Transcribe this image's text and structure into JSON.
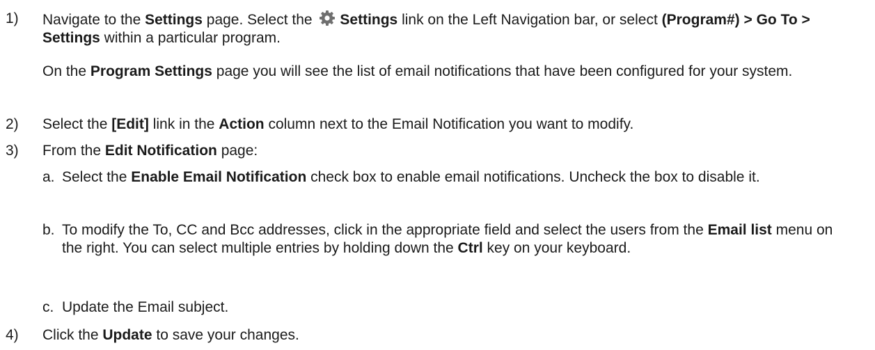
{
  "steps": [
    {
      "num": "1)",
      "a1": "Navigate to the ",
      "a2": "Settings",
      "a3": " page. Select the ",
      "a4": "Settings",
      "a5": " link on the Left Navigation bar, or select ",
      "a6": "(Program#) > Go To > Settings",
      "a7": " within a particular program.",
      "p1": "On the ",
      "p2": "Program Settings",
      "p3": " page you will see the list of email notifications that have been configured for your system."
    },
    {
      "num": "2)",
      "a1": "Select the ",
      "a2": "[Edit]",
      "a3": " link in the ",
      "a4": "Action",
      "a5": " column next to the Email Notification you want to modify."
    },
    {
      "num": "3)",
      "a1": "From the ",
      "a2": "Edit Notification",
      "a3": " page:"
    },
    {
      "num": "4)",
      "a1": "Click the ",
      "a2": "Update",
      "a3": " to save your changes."
    }
  ],
  "substeps": [
    {
      "letter": "a.",
      "a1": "Select the ",
      "a2": "Enable Email Notification",
      "a3": " check box to enable email notifications. Uncheck the box to disable it."
    },
    {
      "letter": "b.",
      "a1": "To modify the To, CC and Bcc addresses, click in the appropriate field and select the users from the ",
      "a2": "Email list",
      "a3": " menu on the right. You can select multiple entries by holding down the ",
      "a4": "Ctrl",
      "a5": " key on your keyboard."
    },
    {
      "letter": "c.",
      "a1": "Update the Email subject."
    }
  ],
  "icons": {
    "settings": "gear-icon",
    "gear_color": "#6f6f6f"
  }
}
